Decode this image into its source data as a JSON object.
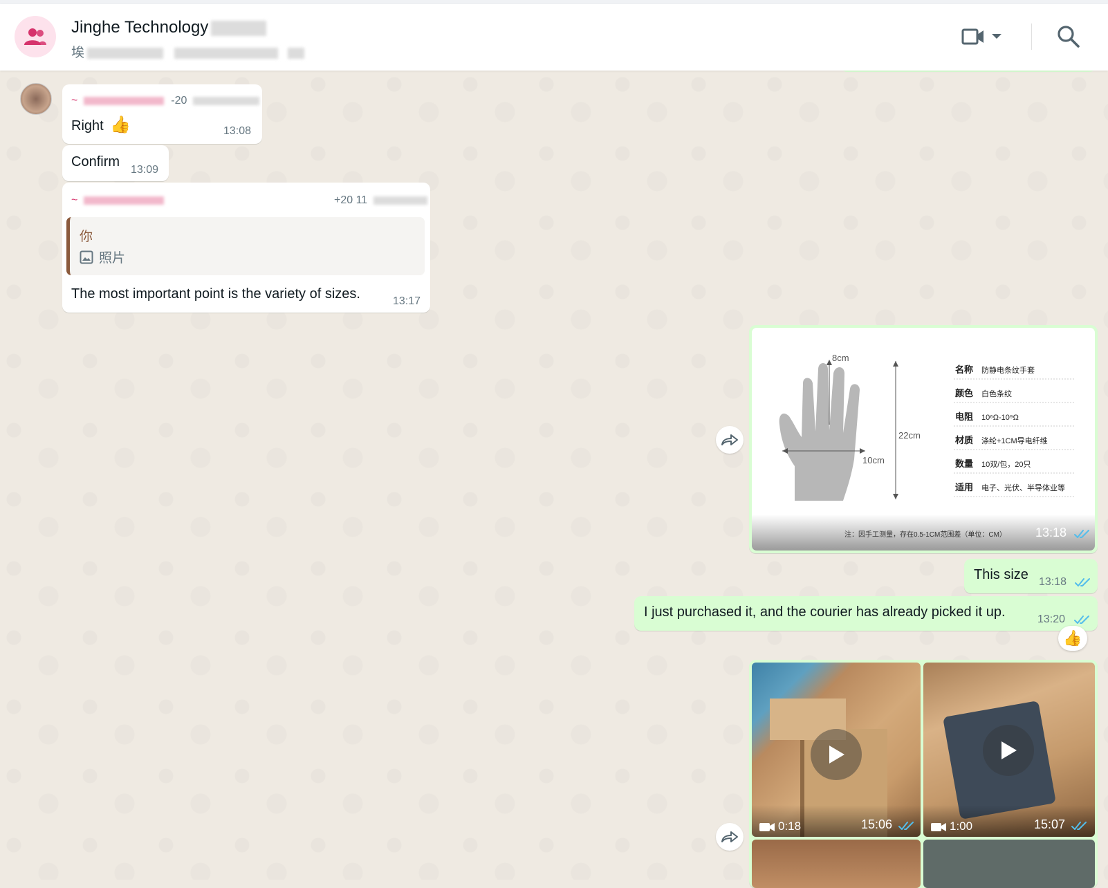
{
  "header": {
    "title": "Jinghe Technology",
    "subtitle_prefix": "埃"
  },
  "messages": [
    {
      "sender_prefix": "~",
      "sender_phone_part": "-20",
      "text": "Right",
      "emoji": "👍",
      "time": "13:08"
    },
    {
      "text": "Confirm",
      "time": "13:09"
    },
    {
      "sender_prefix": "~",
      "sender_phone_part": "+20 11",
      "quote_author": "你",
      "quote_kind": "照片",
      "text": "The most important point is the variety of sizes.",
      "time": "13:17"
    }
  ],
  "outgoing": {
    "image_time": "13:18",
    "this_size": {
      "text": "This size",
      "time": "13:18"
    },
    "purchased": {
      "text": "I just purchased it, and the courier has already picked it up.",
      "time": "13:20",
      "reaction": "👍"
    },
    "videos": [
      {
        "duration": "0:18",
        "time": "15:06"
      },
      {
        "duration": "1:00",
        "time": "15:07"
      }
    ]
  },
  "spec_image": {
    "dim_width": "8cm",
    "dim_palm": "10cm",
    "dim_length": "22cm",
    "rows": [
      {
        "label": "名称",
        "value": "防静电条纹手套"
      },
      {
        "label": "颜色",
        "value": "白色条纹"
      },
      {
        "label": "电阻",
        "value": "10⁶Ω-10⁹Ω"
      },
      {
        "label": "材质",
        "value": "涤纶+1CM导电纤维"
      },
      {
        "label": "数量",
        "value": "10双/包，20只"
      },
      {
        "label": "适用",
        "value": "电子、光伏、半导体业等"
      }
    ],
    "note": "注：因手工测量，存在0.5-1CM范围差（单位：CM）"
  },
  "colors": {
    "accent_pink": "#d6336c",
    "outgoing_bubble": "#d9fdd3",
    "read_tick": "#53bdeb"
  }
}
